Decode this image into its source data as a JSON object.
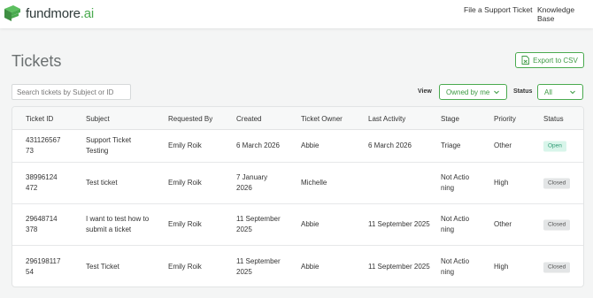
{
  "header": {
    "logo_text_main": "fundmore",
    "logo_text_suffix": ".ai",
    "nav": {
      "support": "File a Support Ticket",
      "knowledge_base": "Knowledge Base"
    }
  },
  "page": {
    "title": "Tickets",
    "export_label": "Export to CSV"
  },
  "filters": {
    "search_placeholder": "Search tickets by Subject or ID",
    "view_label": "View",
    "view_value": "Owned by me",
    "status_label": "Status",
    "status_value": "All"
  },
  "table": {
    "columns": [
      "Ticket ID",
      "Subject",
      "Requested By",
      "Created",
      "Ticket Owner",
      "Last Activity",
      "Stage",
      "Priority",
      "Status"
    ],
    "rows": [
      {
        "id": "43112656773",
        "subject": "Support Ticket Testing",
        "requested_by": "Emily Roik",
        "created": "6 March 2026",
        "owner": "Abbie",
        "last_activity": "6 March 2026",
        "stage": "Triage",
        "priority": "Other",
        "status": "Open"
      },
      {
        "id": "38996124472",
        "subject": "Test ticket",
        "requested_by": "Emily Roik",
        "created": "7 January 2026",
        "owner": "Michelle",
        "last_activity": "",
        "stage": "Not Actioning",
        "priority": "High",
        "status": "Closed"
      },
      {
        "id": "29648714378",
        "subject": "I want to test how to submit a ticket",
        "requested_by": "Emily Roik",
        "created": "11 September 2025",
        "owner": "Abbie",
        "last_activity": "11 September 2025",
        "stage": "Not Actioning",
        "priority": "Other",
        "status": "Closed"
      },
      {
        "id": "29619811754",
        "subject": "Test Ticket",
        "requested_by": "Emily Roik",
        "created": "11 September 2025",
        "owner": "Abbie",
        "last_activity": "11 September 2025",
        "stage": "Not Actioning",
        "priority": "High",
        "status": "Closed"
      }
    ]
  },
  "colors": {
    "brand_green": "#4aaa4f",
    "open_badge_bg": "#d8f5ea",
    "closed_badge_bg": "#e3e5e6"
  }
}
